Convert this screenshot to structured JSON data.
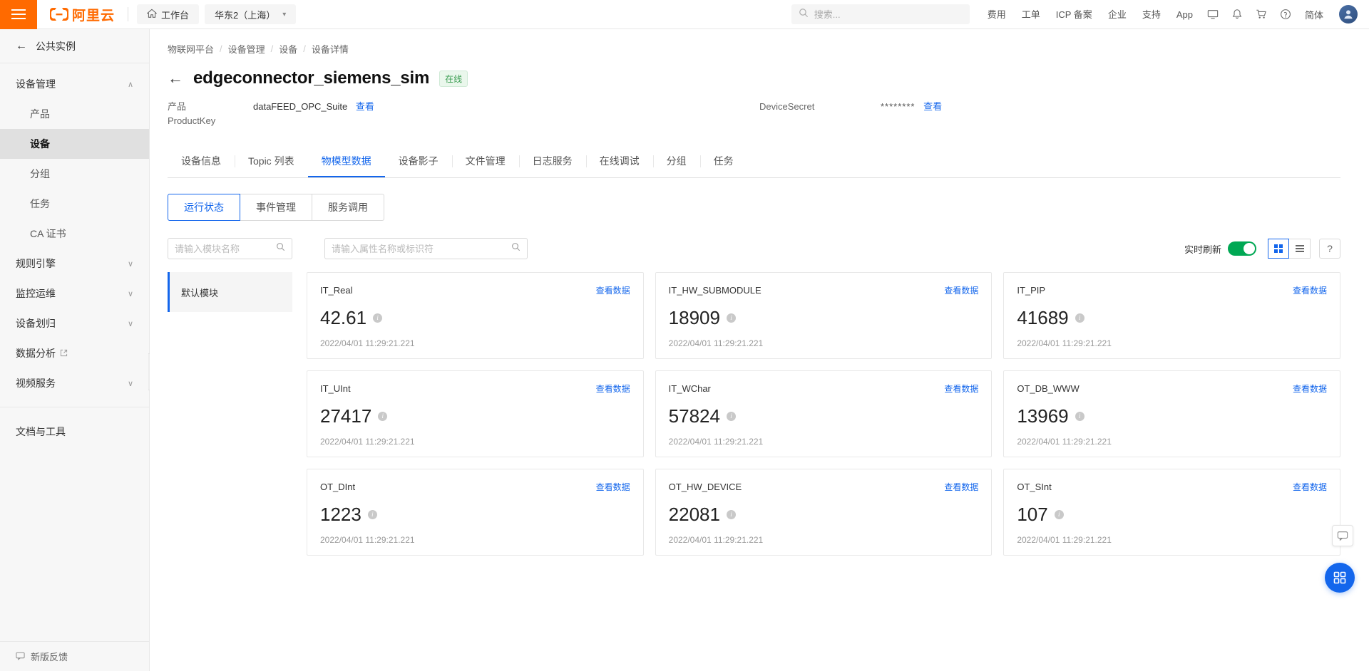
{
  "topnav": {
    "menu_icon": "hamburger-icon",
    "brand": "阿里云",
    "workbench": "工作台",
    "region": "华东2（上海）",
    "search_placeholder": "搜索...",
    "links": [
      "费用",
      "工单",
      "ICP 备案",
      "企业",
      "支持",
      "App"
    ],
    "icons": [
      "screen-icon",
      "bell-icon",
      "cart-icon",
      "question-icon"
    ],
    "language": "简体",
    "avatar": "user-avatar"
  },
  "sidebar": {
    "back_label": "公共实例",
    "groups": [
      {
        "label": "设备管理",
        "expanded": true,
        "items": [
          {
            "label": "产品",
            "active": false
          },
          {
            "label": "设备",
            "active": true
          },
          {
            "label": "分组",
            "active": false
          },
          {
            "label": "任务",
            "active": false
          },
          {
            "label": "CA 证书",
            "active": false
          }
        ]
      },
      {
        "label": "规则引擎",
        "expanded": false,
        "items": []
      },
      {
        "label": "监控运维",
        "expanded": false,
        "items": []
      },
      {
        "label": "设备划归",
        "expanded": false,
        "items": []
      }
    ],
    "external_items": [
      {
        "label": "数据分析",
        "external": true
      },
      {
        "label": "视频服务",
        "external": false,
        "chevron": true
      }
    ],
    "docs_label": "文档与工具",
    "footer_label": "新版反馈"
  },
  "main": {
    "breadcrumb": [
      "物联网平台",
      "设备管理",
      "设备",
      "设备详情"
    ],
    "title": "edgeconnector_siemens_sim",
    "status": "在线",
    "meta": {
      "product_label": "产品",
      "productkey_label": "ProductKey",
      "product_value": "dataFEED_OPC_Suite",
      "product_link": "查看",
      "secret_label": "DeviceSecret",
      "secret_value": "********",
      "secret_link": "查看"
    },
    "tabs": [
      {
        "label": "设备信息",
        "active": false
      },
      {
        "label": "Topic 列表",
        "active": false
      },
      {
        "label": "物模型数据",
        "active": true
      },
      {
        "label": "设备影子",
        "active": false
      },
      {
        "label": "文件管理",
        "active": false
      },
      {
        "label": "日志服务",
        "active": false
      },
      {
        "label": "在线调试",
        "active": false
      },
      {
        "label": "分组",
        "active": false
      },
      {
        "label": "任务",
        "active": false
      }
    ],
    "subtabs": [
      {
        "label": "运行状态",
        "active": true
      },
      {
        "label": "事件管理",
        "active": false
      },
      {
        "label": "服务调用",
        "active": false
      }
    ],
    "filters": {
      "module_placeholder": "请输入模块名称",
      "module_value": "",
      "property_placeholder": "请输入属性名称或标识符",
      "property_value": "",
      "realtime_label": "实时刷新",
      "realtime_on": true,
      "view_grid": "grid-view-icon",
      "view_list": "list-view-icon",
      "help": "?"
    },
    "modules": [
      {
        "label": "默认模块",
        "active": true
      }
    ],
    "card_link_label": "查看数据",
    "cards": [
      {
        "name": "IT_Real",
        "value": "42.61",
        "time": "2022/04/01 11:29:21.221"
      },
      {
        "name": "IT_HW_SUBMODULE",
        "value": "18909",
        "time": "2022/04/01 11:29:21.221"
      },
      {
        "name": "IT_PIP",
        "value": "41689",
        "time": "2022/04/01 11:29:21.221"
      },
      {
        "name": "IT_UInt",
        "value": "27417",
        "time": "2022/04/01 11:29:21.221"
      },
      {
        "name": "IT_WChar",
        "value": "57824",
        "time": "2022/04/01 11:29:21.221"
      },
      {
        "name": "OT_DB_WWW",
        "value": "13969",
        "time": "2022/04/01 11:29:21.221"
      },
      {
        "name": "OT_DInt",
        "value": "1223",
        "time": "2022/04/01 11:29:21.221"
      },
      {
        "name": "OT_HW_DEVICE",
        "value": "22081",
        "time": "2022/04/01 11:29:21.221"
      },
      {
        "name": "OT_SInt",
        "value": "107",
        "time": "2022/04/01 11:29:21.221"
      }
    ]
  },
  "colors": {
    "brand_orange": "#ff6a00",
    "link_blue": "#1366ec",
    "toggle_green": "#00a854",
    "status_green": "#3c9e53"
  }
}
